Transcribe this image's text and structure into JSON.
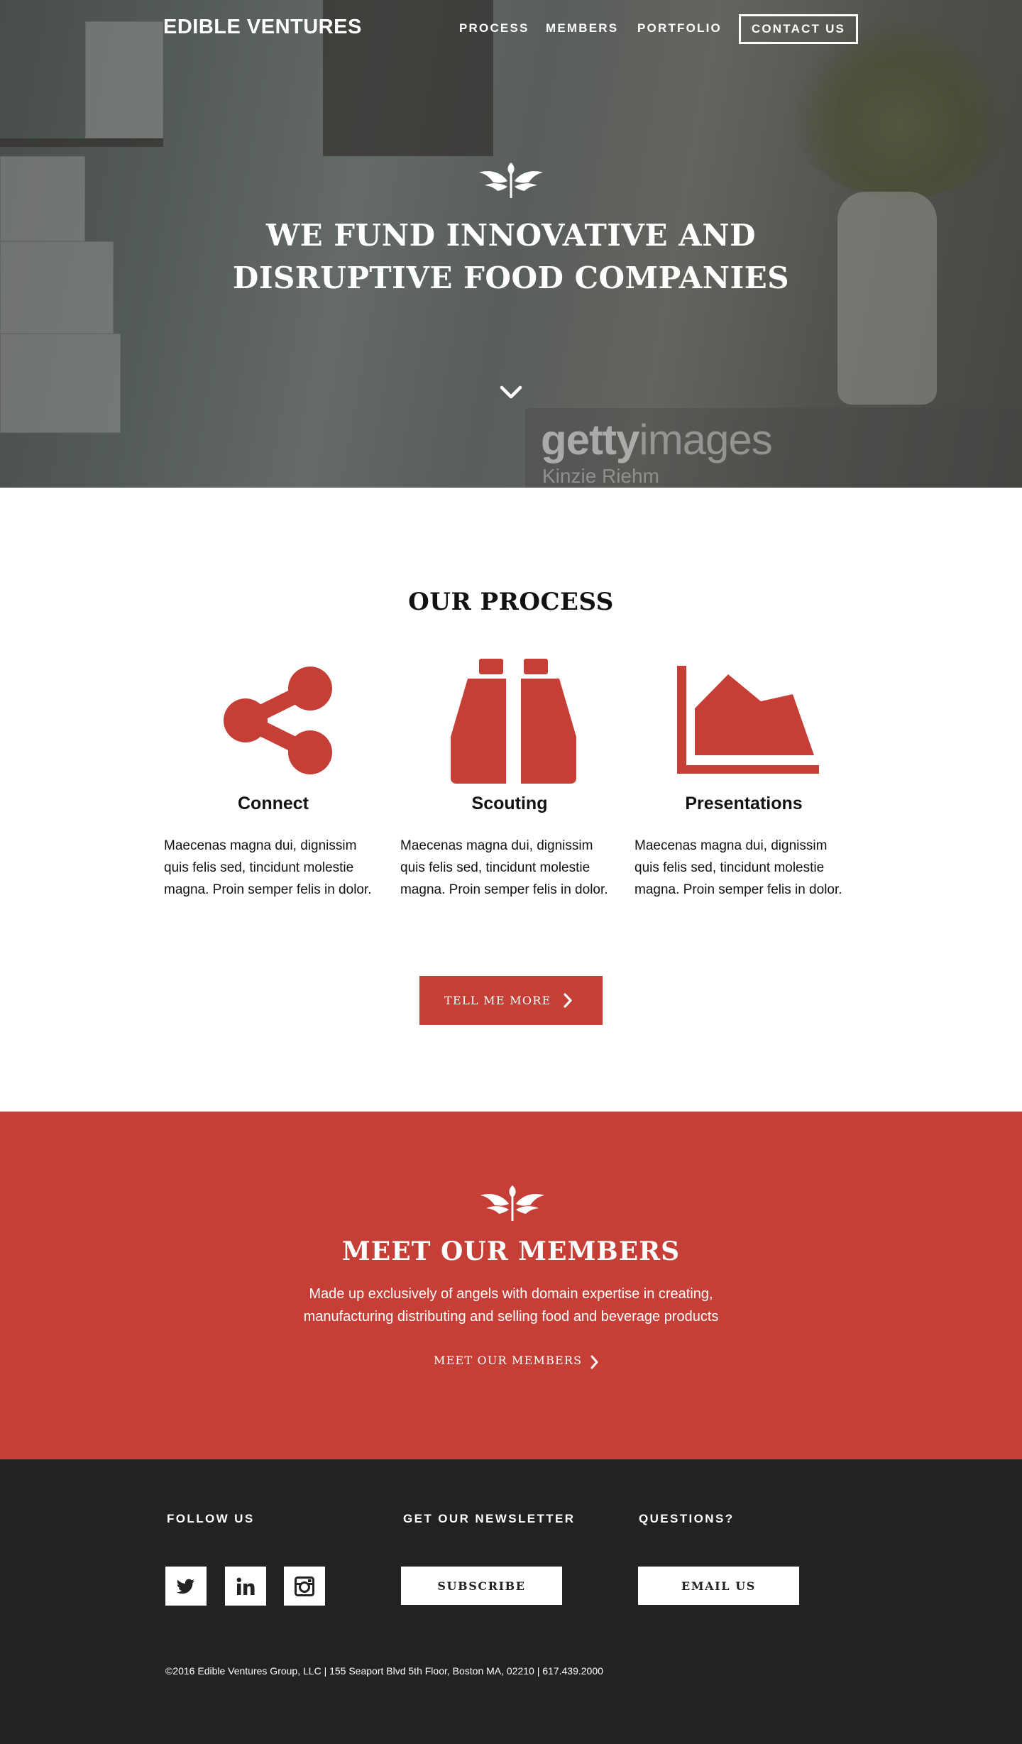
{
  "brand": {
    "name": "EDIBLE VENTURES",
    "accent": "#c53f36",
    "footer_bg": "#222222"
  },
  "nav": {
    "items": [
      {
        "label": "PROCESS"
      },
      {
        "label": "MEMBERS"
      },
      {
        "label": "PORTFOLIO"
      }
    ],
    "cta": "CONTACT US"
  },
  "hero": {
    "icon": "sprout-wings-icon",
    "title": "WE FUND INNOVATIVE AND DISRUPTIVE FOOD COMPANIES",
    "scroll_icon": "chevron-down-icon",
    "watermark": {
      "brand_bold": "getty",
      "brand_rest": "images",
      "credit": "Kinzie Riehm"
    }
  },
  "process": {
    "title": "OUR PROCESS",
    "items": [
      {
        "icon": "share-icon",
        "heading": "Connect",
        "text": "Maecenas magna dui, dignissim quis felis sed, tincidunt molestie magna. Proin semper felis in dolor."
      },
      {
        "icon": "binoculars-icon",
        "heading": "Scouting",
        "text": "Maecenas magna dui, dignissim quis felis sed, tincidunt molestie magna. Proin semper felis in dolor."
      },
      {
        "icon": "area-chart-icon",
        "heading": "Presentations",
        "text": "Maecenas magna dui, dignissim quis felis sed, tincidunt molestie magna. Proin semper felis in dolor."
      }
    ],
    "button": "TELL ME MORE"
  },
  "members": {
    "icon": "sprout-wings-icon",
    "title": "MEET OUR MEMBERS",
    "description": "Made up exclusively of angels with domain expertise in creating, manufacturing distributing and selling food and beverage products",
    "link": "MEET OUR MEMBERS"
  },
  "footer": {
    "follow_heading": "FOLLOW US",
    "social": [
      "twitter-icon",
      "linkedin-icon",
      "instagram-icon"
    ],
    "newsletter_heading": "GET OUR NEWSLETTER",
    "newsletter_button": "SUBSCRIBE",
    "questions_heading": "QUESTIONS?",
    "questions_button": "EMAIL US",
    "copyright": "©2016 Edible Ventures Group, LLC | 155 Seaport Blvd 5th Floor, Boston MA, 02210 | 617.439.2000"
  }
}
